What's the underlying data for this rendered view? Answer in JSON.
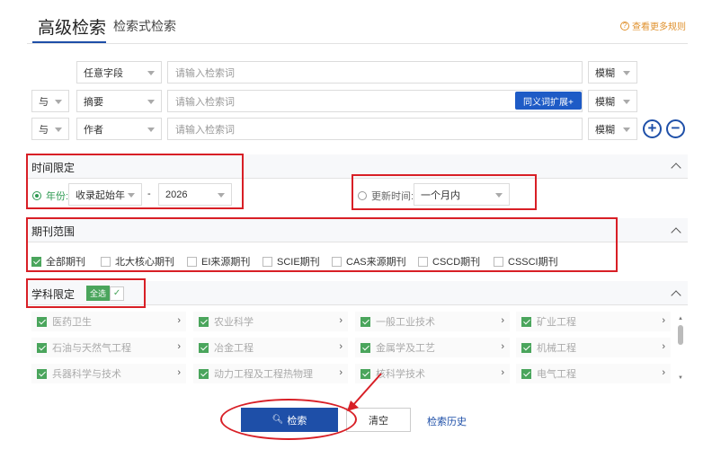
{
  "header": {
    "tab_advanced": "高级检索",
    "tab_expression": "检索式检索",
    "help_link": "查看更多规则",
    "help_icon": "question-circle-icon"
  },
  "rows": [
    {
      "logic": "",
      "field": "任意字段",
      "placeholder": "请输入检索词",
      "match": "模糊",
      "synonym": ""
    },
    {
      "logic": "与",
      "field": "摘要",
      "placeholder": "请输入检索词",
      "match": "模糊",
      "synonym": "同义词扩展+"
    },
    {
      "logic": "与",
      "field": "作者",
      "placeholder": "请输入检索词",
      "match": "模糊",
      "synonym": ""
    }
  ],
  "add_button": "+",
  "remove_button": "−",
  "time": {
    "title": "时间限定",
    "year_label": "年份:",
    "year_from": "收录起始年",
    "dash": "-",
    "year_to": "2026",
    "update_label": "更新时间:",
    "update_value": "一个月内",
    "selected": "year"
  },
  "journal": {
    "title": "期刊范围",
    "options": [
      {
        "label": "全部期刊",
        "checked": true
      },
      {
        "label": "北大核心期刊",
        "checked": false
      },
      {
        "label": "EI来源期刊",
        "checked": false
      },
      {
        "label": "SCIE期刊",
        "checked": false
      },
      {
        "label": "CAS来源期刊",
        "checked": false
      },
      {
        "label": "CSCD期刊",
        "checked": false
      },
      {
        "label": "CSSCI期刊",
        "checked": false
      }
    ]
  },
  "subject": {
    "title": "学科限定",
    "select_all": "全选",
    "items": [
      "医药卫生",
      "农业科学",
      "一般工业技术",
      "矿业工程",
      "石油与天然气工程",
      "冶金工程",
      "金属学及工艺",
      "机械工程",
      "兵器科学与技术",
      "动力工程及工程热物理",
      "核科学技术",
      "电气工程"
    ]
  },
  "actions": {
    "search": "检索",
    "clear": "清空",
    "history": "检索历史"
  },
  "colors": {
    "accent": "#1e4fa8",
    "annotation": "#d81f26",
    "checked": "#4aa55c"
  }
}
